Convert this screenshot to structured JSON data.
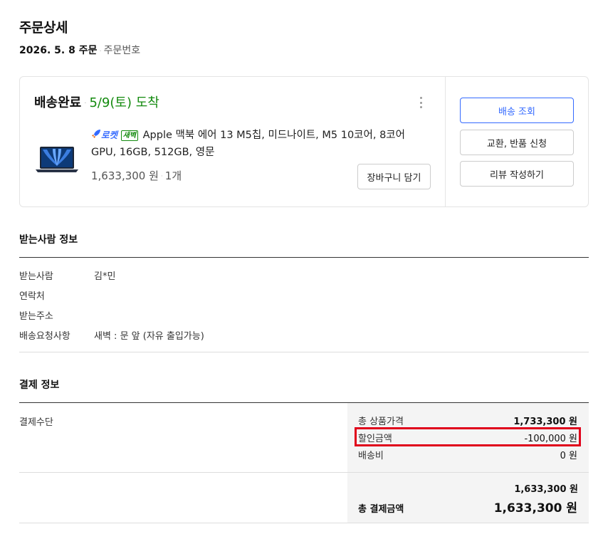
{
  "header": {
    "title": "주문상세",
    "order_date": "2026. 5. 8 주문",
    "order_number_label": "주문번호"
  },
  "order_card": {
    "status": "배송완료",
    "arrival": "5/9(토) 도착",
    "rocket_label": "로켓",
    "dawn_badge": "새벽",
    "product_name": "Apple 맥북 에어 13 M5칩, 미드나이트, M5 10코어, 8코어 GPU, 16GB, 512GB, 영문",
    "price": "1,633,300 원",
    "quantity": "1개",
    "cart_button": "장바구니 담기",
    "track_button": "배송 조회",
    "exchange_button": "교환, 반품 신청",
    "review_button": "리뷰 작성하기",
    "icons": {
      "more": "more-vertical-icon",
      "rocket": "rocket-icon",
      "thumbnail": "laptop-thumbnail"
    },
    "colors": {
      "arrival": "#138a0e",
      "rocket": "#346aff",
      "primary_button": "#346aff"
    }
  },
  "recipient": {
    "title": "받는사람 정보",
    "rows": [
      {
        "label": "받는사람",
        "value": "김*민"
      },
      {
        "label": "연락처",
        "value": ""
      },
      {
        "label": "받는주소",
        "value": ""
      },
      {
        "label": "배송요청사항",
        "value": "새벽 : 문 앞 (자유 출입가능)"
      }
    ]
  },
  "payment": {
    "title": "결제 정보",
    "method_label": "결제수단",
    "rows": [
      {
        "label": "총 상품가격",
        "value": "1,733,300 원"
      },
      {
        "label": "할인금액",
        "value": "-100,000 원"
      },
      {
        "label": "배송비",
        "value": "0 원"
      }
    ],
    "subtotal": "1,633,300 원",
    "total_label": "총 결제금액",
    "total": "1,633,300 원",
    "highlight_color": "#e0001b"
  }
}
